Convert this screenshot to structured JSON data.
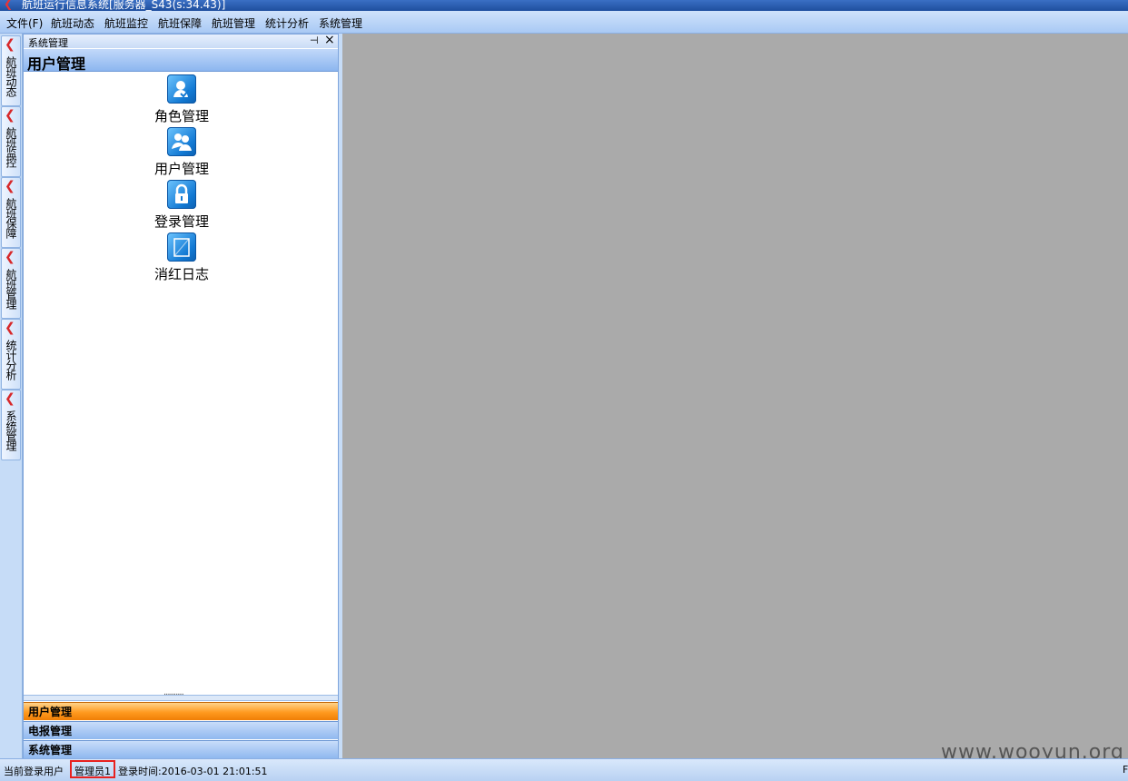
{
  "window": {
    "title": "航班运行信息系统[服务器_S43(s:34.43)]"
  },
  "menubar": {
    "items": [
      "文件(F)",
      "航班动态",
      "航班监控",
      "航班保障",
      "航班管理",
      "统计分析",
      "系统管理"
    ]
  },
  "left_tabs": [
    "航班动态",
    "航班监控",
    "航班保障",
    "航班管理",
    "统计分析",
    "系统管理"
  ],
  "panel": {
    "caption": "系统管理",
    "group_title": "用户管理",
    "tiles": [
      {
        "label": "角色管理",
        "icon": "role-user-check-icon"
      },
      {
        "label": "用户管理",
        "icon": "users-icon"
      },
      {
        "label": "登录管理",
        "icon": "lock-icon"
      },
      {
        "label": "消红日志",
        "icon": "log-icon"
      }
    ],
    "nav_buttons": [
      "用户管理",
      "电报管理",
      "系统管理"
    ],
    "active_nav": "用户管理"
  },
  "statusbar": {
    "current_user_label": "当前登录用户",
    "current_user": "管理员1",
    "login_time": "登录时间:2016-03-01  21:01:51",
    "right_text": "F"
  },
  "watermark": "www.wooyun.org",
  "colors": {
    "accent_active": "#ff9a1f",
    "highlight_box": "#e8211f",
    "workspace": "#aaaaaa"
  }
}
